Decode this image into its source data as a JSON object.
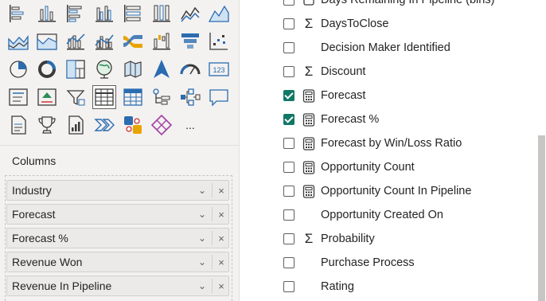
{
  "visualizations": {
    "icons": [
      "stacked-bar-chart-icon",
      "stacked-column-chart-icon",
      "clustered-bar-chart-icon",
      "clustered-column-chart-icon",
      "100-stacked-bar-chart-icon",
      "100-stacked-column-chart-icon",
      "line-chart-icon",
      "area-chart-icon",
      "stacked-area-chart-icon",
      "100-stacked-area-chart-icon",
      "line-and-stacked-column-chart-icon",
      "line-and-clustered-column-chart-icon",
      "ribbon-chart-icon",
      "waterfall-chart-icon",
      "funnel-chart-icon",
      "scatter-chart-icon",
      "pie-chart-icon",
      "donut-chart-icon",
      "treemap-icon",
      "map-icon",
      "filled-map-icon",
      "azure-map-icon",
      "gauge-icon",
      "card-icon",
      "multi-row-card-icon",
      "kpi-icon",
      "slicer-icon",
      "table-icon",
      "matrix-icon",
      "key-influencers-icon",
      "decomposition-tree-icon",
      "qa-icon",
      "paginated-report-icon",
      "trophy-icon",
      "metrics-icon",
      "power-automate-icon",
      "python-visual-icon",
      "power-apps-icon",
      "more-visuals-icon"
    ],
    "more_label": "..."
  },
  "columns": {
    "title": "Columns",
    "items": [
      {
        "label": "Industry"
      },
      {
        "label": "Forecast"
      },
      {
        "label": "Forecast %"
      },
      {
        "label": "Revenue Won"
      },
      {
        "label": "Revenue In Pipeline"
      }
    ],
    "chevron": "⌄",
    "remove": "×"
  },
  "fields": [
    {
      "label": "Days Remaining In Pipeline (bins)",
      "icon": "bins-icon",
      "symbol": "",
      "checked": false
    },
    {
      "label": "DaysToClose",
      "icon": "sigma-icon",
      "symbol": "Σ",
      "checked": false
    },
    {
      "label": "Decision Maker Identified",
      "icon": "",
      "symbol": "",
      "checked": false
    },
    {
      "label": "Discount",
      "icon": "sigma-icon",
      "symbol": "Σ",
      "checked": false
    },
    {
      "label": "Forecast",
      "icon": "calculator-icon",
      "symbol": "",
      "checked": true
    },
    {
      "label": "Forecast %",
      "icon": "calculator-icon",
      "symbol": "",
      "checked": true
    },
    {
      "label": "Forecast by Win/Loss Ratio",
      "icon": "calculator-icon",
      "symbol": "",
      "checked": false
    },
    {
      "label": "Opportunity Count",
      "icon": "calculator-icon",
      "symbol": "",
      "checked": false
    },
    {
      "label": "Opportunity Count In Pipeline",
      "icon": "calculator-icon",
      "symbol": "",
      "checked": false
    },
    {
      "label": "Opportunity Created On",
      "icon": "",
      "symbol": "",
      "checked": false
    },
    {
      "label": "Probability",
      "icon": "sigma-icon",
      "symbol": "Σ",
      "checked": false
    },
    {
      "label": "Purchase Process",
      "icon": "",
      "symbol": "",
      "checked": false
    },
    {
      "label": "Rating",
      "icon": "",
      "symbol": "",
      "checked": false
    }
  ],
  "colors": {
    "accent": "#117865",
    "icon_blue": "#2b6cb0",
    "icon_yellow": "#e8a400",
    "icon_dark": "#3b3a39"
  }
}
